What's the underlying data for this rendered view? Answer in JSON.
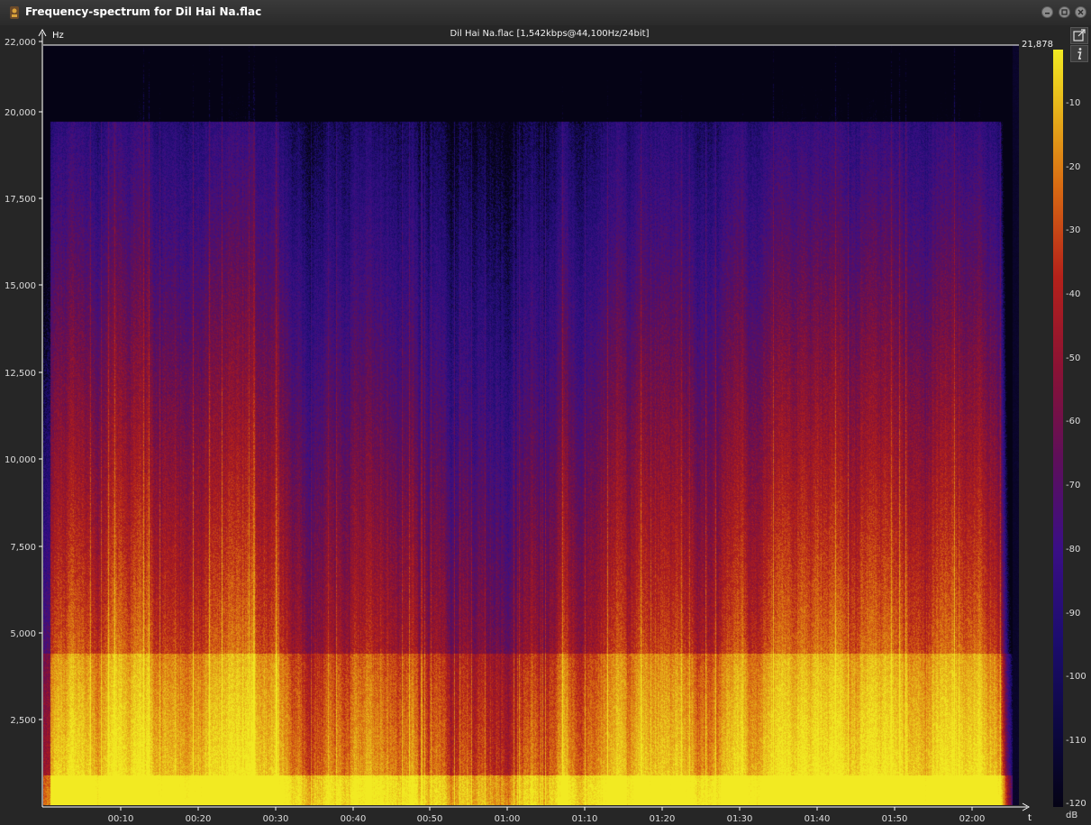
{
  "window": {
    "title": "Frequency-spectrum for Dil Hai Na.flac",
    "buttons": [
      "minimize-icon",
      "maximize-icon",
      "close-icon"
    ]
  },
  "plot": {
    "file_info": "Dil Hai Na.flac [1,542kbps@44,100Hz/24bit]",
    "y_unit": "Hz",
    "x_unit": "t",
    "max_frequency_label": "21,878",
    "y_ticks": [
      "22,000",
      "20,000",
      "17,500",
      "15,000",
      "12,500",
      "10,000",
      "7,500",
      "5,000",
      "2,500"
    ],
    "x_ticks": [
      "00:10",
      "00:20",
      "00:30",
      "00:40",
      "00:50",
      "01:00",
      "01:10",
      "01:20",
      "01:30",
      "01:40",
      "01:50",
      "02:00"
    ],
    "colorscale": {
      "unit": "dB",
      "ticks": [
        "-10",
        "-20",
        "-30",
        "-40",
        "-50",
        "-60",
        "-70",
        "-80",
        "-90",
        "-100",
        "-110",
        "-120"
      ],
      "colors": [
        "#f2ea22",
        "#d96b12",
        "#b4211a",
        "#5e0f5a",
        "#3a0f85",
        "#050315"
      ]
    },
    "tools": [
      "export-icon",
      "info-icon"
    ]
  }
}
